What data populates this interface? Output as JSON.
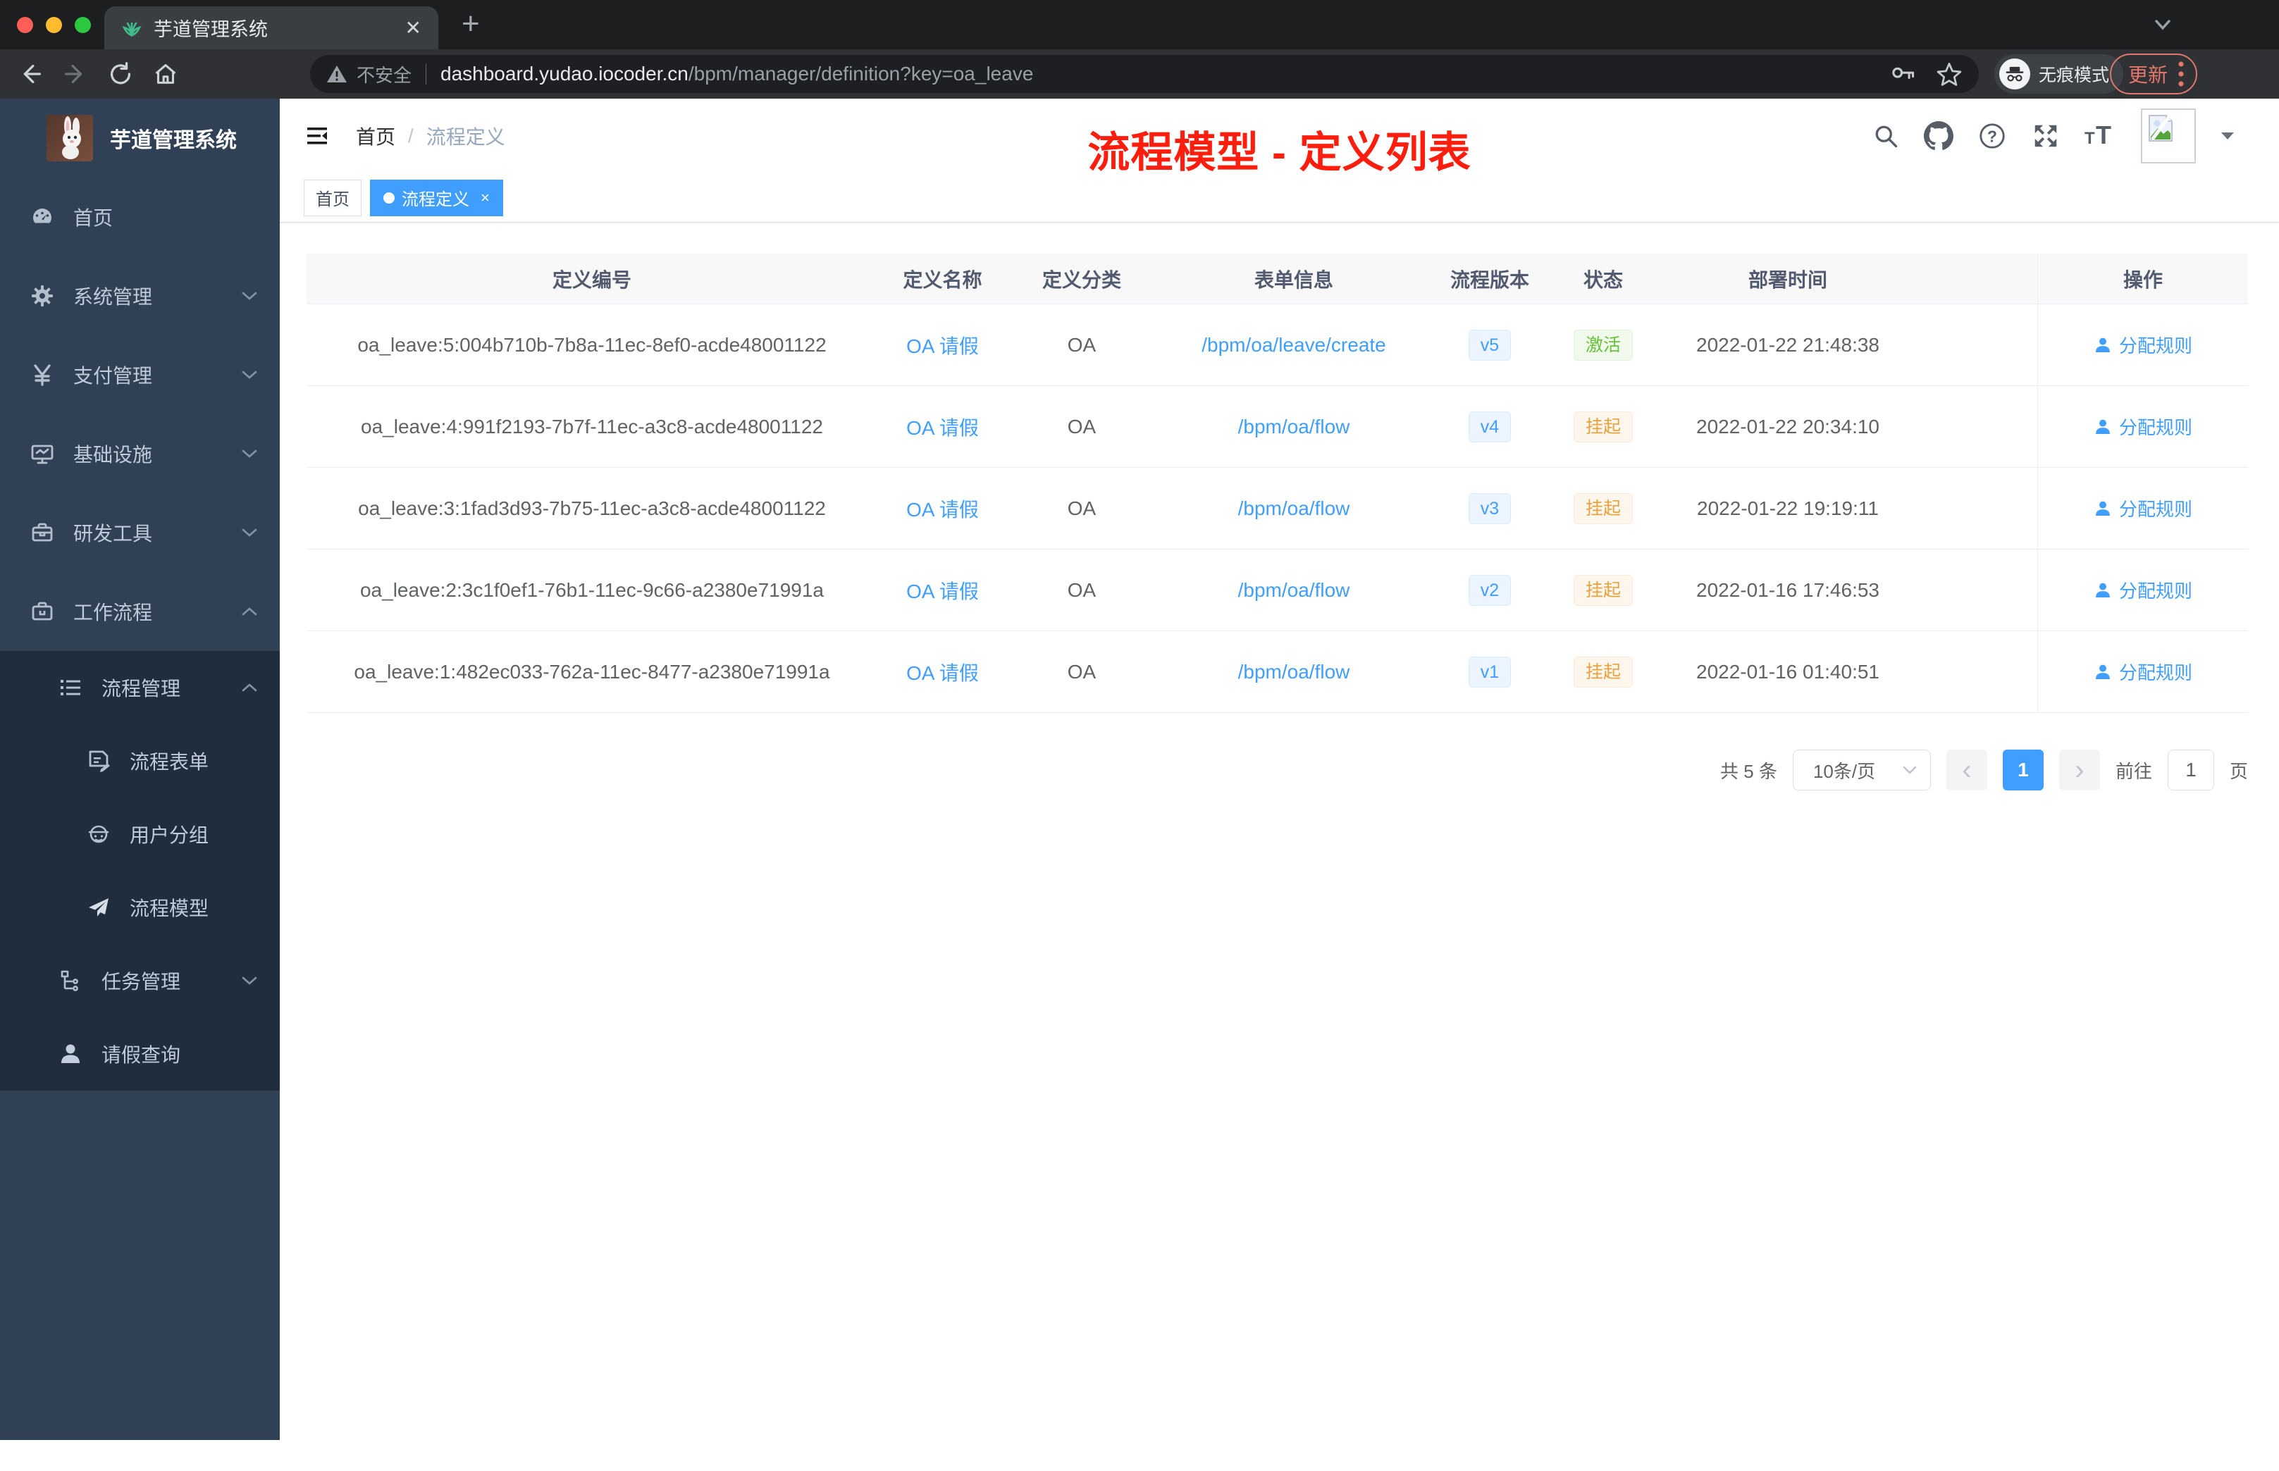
{
  "colors": {
    "accent": "#409eff",
    "success": "#67c23a",
    "warning": "#e6a23c",
    "annotation_red": "#ff1e0d",
    "sidebar_bg": "#304156"
  },
  "browser": {
    "tab_title": "芋道管理系统",
    "security_label": "不安全",
    "url_host": "dashboard.yudao.iocoder.cn",
    "url_path": "/bpm/manager/definition?key=oa_leave",
    "incognito_label": "无痕模式",
    "update_label": "更新"
  },
  "icons": {
    "close": "✕",
    "plus": "+",
    "tag_close": "×",
    "prev": "‹",
    "next": "›"
  },
  "sidebar": {
    "title": "芋道管理系统",
    "items": [
      {
        "label": "首页"
      },
      {
        "label": "系统管理"
      },
      {
        "label": "支付管理"
      },
      {
        "label": "基础设施"
      },
      {
        "label": "研发工具"
      },
      {
        "label": "工作流程"
      },
      {
        "label": "流程管理"
      },
      {
        "label": "流程表单"
      },
      {
        "label": "用户分组"
      },
      {
        "label": "流程模型"
      },
      {
        "label": "任务管理"
      },
      {
        "label": "请假查询"
      }
    ]
  },
  "navbar": {
    "breadcrumb_home": "首页",
    "breadcrumb_separator": "/",
    "breadcrumb_current": "流程定义",
    "annotation": "流程模型 - 定义列表"
  },
  "tags": {
    "home": "首页",
    "active": "流程定义"
  },
  "table": {
    "columns": [
      "定义编号",
      "定义名称",
      "定义分类",
      "表单信息",
      "流程版本",
      "状态",
      "部署时间",
      "操作"
    ],
    "rows": [
      {
        "id": "oa_leave:5:004b710b-7b8a-11ec-8ef0-acde48001122",
        "name": "OA 请假",
        "category": "OA",
        "form": "/bpm/oa/leave/create",
        "version": "v5",
        "status": "激活",
        "status_type": "success",
        "deploy_time": "2022-01-22 21:48:38",
        "action": "分配规则"
      },
      {
        "id": "oa_leave:4:991f2193-7b7f-11ec-a3c8-acde48001122",
        "name": "OA 请假",
        "category": "OA",
        "form": "/bpm/oa/flow",
        "version": "v4",
        "status": "挂起",
        "status_type": "warning",
        "deploy_time": "2022-01-22 20:34:10",
        "action": "分配规则"
      },
      {
        "id": "oa_leave:3:1fad3d93-7b75-11ec-a3c8-acde48001122",
        "name": "OA 请假",
        "category": "OA",
        "form": "/bpm/oa/flow",
        "version": "v3",
        "status": "挂起",
        "status_type": "warning",
        "deploy_time": "2022-01-22 19:19:11",
        "action": "分配规则"
      },
      {
        "id": "oa_leave:2:3c1f0ef1-76b1-11ec-9c66-a2380e71991a",
        "name": "OA 请假",
        "category": "OA",
        "form": "/bpm/oa/flow",
        "version": "v2",
        "status": "挂起",
        "status_type": "warning",
        "deploy_time": "2022-01-16 17:46:53",
        "action": "分配规则"
      },
      {
        "id": "oa_leave:1:482ec033-762a-11ec-8477-a2380e71991a",
        "name": "OA 请假",
        "category": "OA",
        "form": "/bpm/oa/flow",
        "version": "v1",
        "status": "挂起",
        "status_type": "warning",
        "deploy_time": "2022-01-16 01:40:51",
        "action": "分配规则"
      }
    ]
  },
  "pagination": {
    "total": "共 5 条",
    "page_size": "10条/页",
    "current_page": "1",
    "goto_label": "前往",
    "page_unit": "页",
    "goto_value": "1"
  }
}
